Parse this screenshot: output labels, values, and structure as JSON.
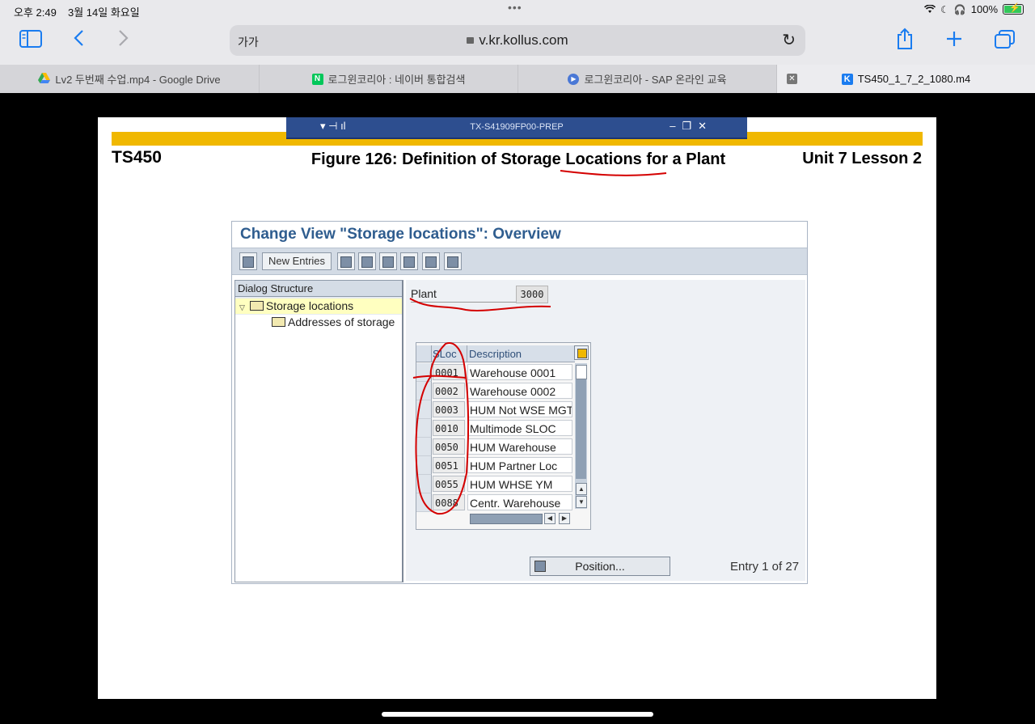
{
  "status_bar": {
    "time": "오후 2:49",
    "date": "3월 14일 화요일",
    "battery": "100%"
  },
  "browser": {
    "text_size": "가가",
    "url": "v.kr.kollus.com",
    "tabs": [
      {
        "label": "Lv2 두번째 수업.mp4 - Google Drive",
        "fav_color": "#34a853"
      },
      {
        "label": "로그윈코리아 : 네이버 통합검색",
        "fav_color": "#03c75a",
        "fav_letter": "N"
      },
      {
        "label": "로그윈코리아 - SAP 온라인 교육",
        "fav_color": "#4a78d6"
      },
      {
        "label": "TS450_1_7_2_1080.m4",
        "fav_color": "#1a7cf0",
        "fav_letter": "K"
      }
    ]
  },
  "slide": {
    "window_caption": "TX-S41909FP00-PREP",
    "course": "TS450",
    "figure_title": "Figure 126: Definition of Storage Locations for a Plant",
    "unit": "Unit 7 Lesson 2"
  },
  "sap": {
    "title": "Change View \"Storage locations\": Overview",
    "new_entries_label": "New Entries",
    "dialog_structure_label": "Dialog Structure",
    "tree": {
      "item1": "Storage locations",
      "item2": "Addresses of storage"
    },
    "plant_label": "Plant",
    "plant_value": "3000",
    "columns": {
      "sloc": "SLoc",
      "description": "Description"
    },
    "rows": [
      {
        "sloc": "0001",
        "desc": "Warehouse 0001"
      },
      {
        "sloc": "0002",
        "desc": "Warehouse 0002"
      },
      {
        "sloc": "0003",
        "desc": "HUM Not WSE MGT"
      },
      {
        "sloc": "0010",
        "desc": "Multimode SLOC"
      },
      {
        "sloc": "0050",
        "desc": "HUM Warehouse"
      },
      {
        "sloc": "0051",
        "desc": "HUM Partner Loc"
      },
      {
        "sloc": "0055",
        "desc": "HUM WHSE YM"
      },
      {
        "sloc": "0088",
        "desc": "Centr. Warehouse"
      }
    ],
    "position_label": "Position...",
    "entry_text": "Entry 1 of 27"
  },
  "colors": {
    "sap_title": "#2f5d8f",
    "gold_bar": "#f0b800",
    "annotation": "#d40000",
    "tree_selected": "#ffffc0"
  }
}
